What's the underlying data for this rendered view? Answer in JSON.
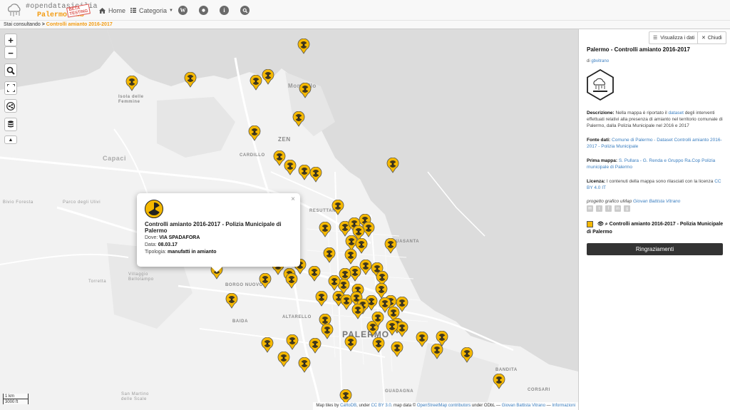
{
  "site": {
    "logo_line1": "#opendatasicilia",
    "logo_line2": "Palermo Hub",
    "beta_badge": "BETA TESTING"
  },
  "nav": {
    "home": "Home",
    "category": "Categoria",
    "icons": [
      "wordpress-icon",
      "github-icon",
      "info-icon",
      "search-icon"
    ]
  },
  "breadcrumb": {
    "prefix": "Stai consultando",
    "current": "Controlli amianto 2016-2017"
  },
  "map": {
    "controls": [
      "zoom-in",
      "zoom-out",
      "search",
      "fullscreen",
      "share",
      "layers",
      "collapse"
    ],
    "place_labels": [
      "Mondello",
      "Isola delle Femmine",
      "ZEN",
      "CARDILLO",
      "Capaci",
      "Bivio Foresta",
      "Parco degli Ulivi",
      "RESUTTANA",
      "Villaggio Bellolampo",
      "Torretta",
      "BORGO NUOVO",
      "BAIDA",
      "ALTARELLO",
      "PALERMO",
      "San Martino delle Scale",
      "GUADAGNA",
      "BANDITA",
      "ACQUASANTA",
      "CORSARI"
    ],
    "scale_km": "1 km",
    "scale_ft": "3000 ft",
    "attribution": {
      "prefix": "Map tiles by",
      "tiles": "CartoDB",
      "under": ", under",
      "license1": "CC BY 3.0",
      "data_by": ". map data ©",
      "osm": "OpenStreetMap contributors",
      "odbl": "under ODbL —",
      "author": "Giovan Battista Vitrano",
      "sep": "—",
      "info": "Informazioni"
    }
  },
  "popup": {
    "title": "Controlli amianto 2016-2017 - Polizia Municipale di Palermo",
    "where_label": "Dove:",
    "where_value": "VIA SPADAFORA",
    "date_label": "Data:",
    "date_value": "08.03.17",
    "type_label": "Tipologia:",
    "type_value": "manufatti in amianto",
    "close": "×"
  },
  "panel": {
    "view_data": "Visualizza i dati",
    "close": "Chiudi",
    "title": "Palermo - Controlli amianto 2016-2017",
    "by_prefix": "di",
    "by_user": "gbvitrano",
    "desc_label": "Descrizione:",
    "desc_text1": "Nella mappa è riportato il",
    "desc_link": "dataset",
    "desc_text2": "degli interventi effettuati relativi alla presenza di amianto nel territorio comunale di Palermo, dalla Polizia Municipale nel 2016 e 2017",
    "source_label": "Fonte dati:",
    "source_link": "Comune di Palermo - Dataset Controlli amianto 2016-2017 - Polizia Municipale",
    "first_label": "Prima mappa:",
    "first_link": "S. Pullara - G. Renda e Gruppo Ra.Cop Polizia municipale di Palermo",
    "license_label": "Licenza:",
    "license_text": "I contenuti della mappa sono rilasciati con la licenza",
    "license_link": "CC BY 4.0 IT",
    "project_text": "progetto grafico uMap",
    "project_author": "Giovan Battista Vitrano",
    "layer_name": "Controlli amianto 2016-2017 - Polizia Municipale di Palermo",
    "thanks_button": "Ringraziamenti",
    "accent": "#f39c12",
    "marker_color": "#f5b800"
  }
}
